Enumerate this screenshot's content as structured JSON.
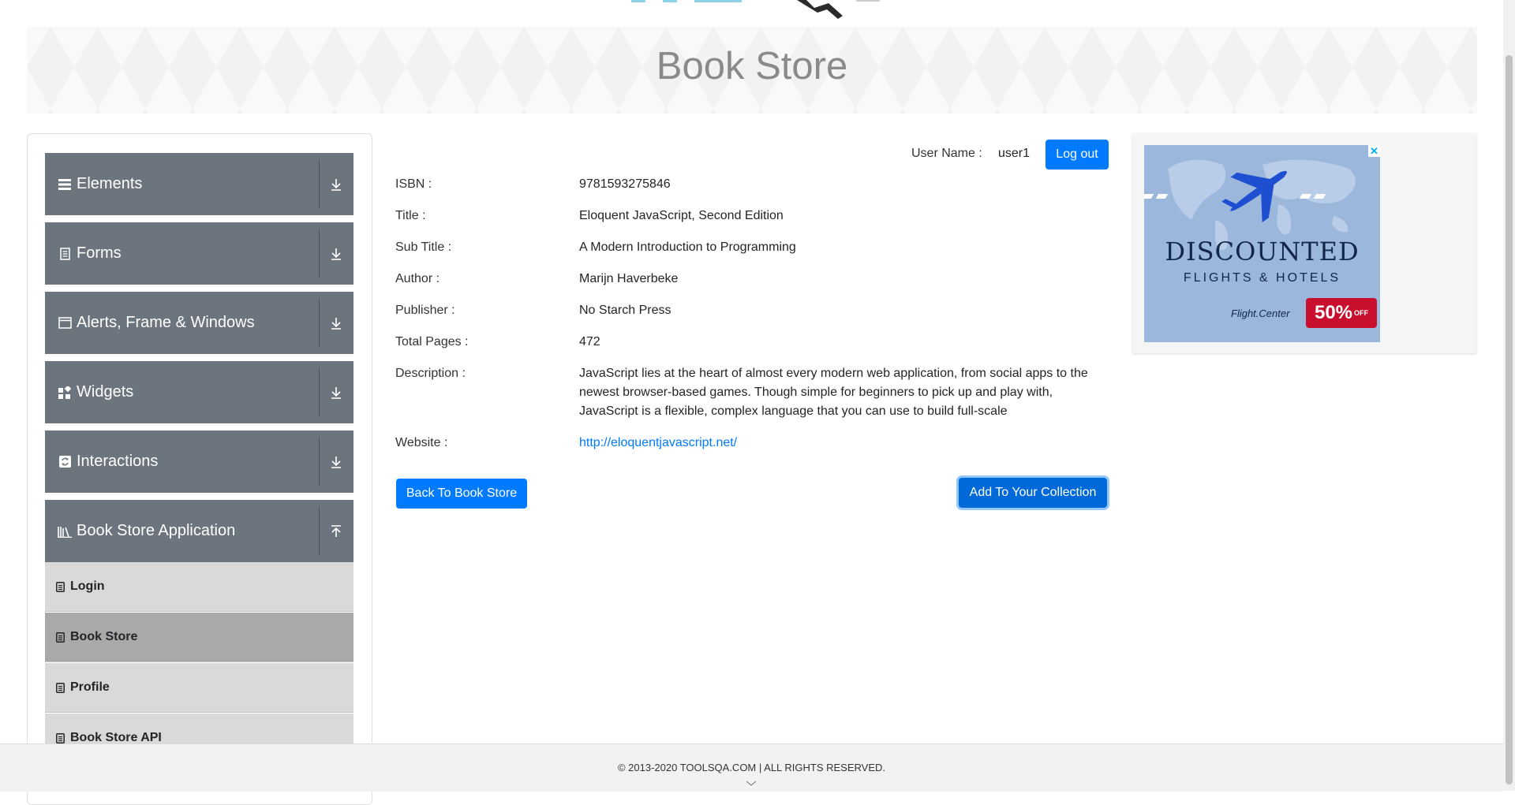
{
  "banner": {
    "title": "Book Store"
  },
  "sidebar": {
    "groups": [
      {
        "label": "Elements",
        "icon": "hamburger-icon"
      },
      {
        "label": "Forms",
        "icon": "document-icon"
      },
      {
        "label": "Alerts, Frame & Windows",
        "icon": "window-icon"
      },
      {
        "label": "Widgets",
        "icon": "widgets-icon"
      },
      {
        "label": "Interactions",
        "icon": "interactions-icon"
      },
      {
        "label": "Book Store Application",
        "icon": "books-icon"
      }
    ],
    "book_store_items": [
      {
        "label": "Login",
        "icon": "page-icon"
      },
      {
        "label": "Book Store",
        "icon": "page-icon"
      },
      {
        "label": "Profile",
        "icon": "page-icon"
      },
      {
        "label": "Book Store API",
        "icon": "page-icon"
      }
    ]
  },
  "user": {
    "label": "User Name :",
    "value": "user1",
    "logout": "Log out"
  },
  "book": {
    "isbn_label": "ISBN :",
    "isbn": "9781593275846",
    "title_label": "Title :",
    "title": "Eloquent JavaScript, Second Edition",
    "subtitle_label": "Sub Title :",
    "subtitle": "A Modern Introduction to Programming",
    "author_label": "Author :",
    "author": "Marijn Haverbeke",
    "publisher_label": "Publisher :",
    "publisher": "No Starch Press",
    "pages_label": "Total Pages :",
    "pages": "472",
    "description_label": "Description :",
    "description": "JavaScript lies at the heart of almost every modern web application, from social apps to the newest browser-based games. Though simple for beginners to pick up and play with, JavaScript is a flexible, complex language that you can use to build full-scale",
    "website_label": "Website :",
    "website": "http://eloquentjavascript.net/"
  },
  "actions": {
    "back": "Back To Book Store",
    "add": "Add To Your Collection"
  },
  "ad": {
    "title": "DISCOUNTED",
    "subtitle": "FLIGHTS & HOTELS",
    "brand": "Flight.Center",
    "discount": "50%",
    "discount_suffix": "OFF",
    "close": "✕"
  },
  "footer": {
    "text": "© 2013-2020 TOOLSQA.COM | ALL RIGHTS RESERVED."
  },
  "colors": {
    "primary": "#007bff",
    "nav_group": "#6c757d",
    "nav_sub": "#d9d9d9",
    "nav_active": "#a9a9a9"
  }
}
